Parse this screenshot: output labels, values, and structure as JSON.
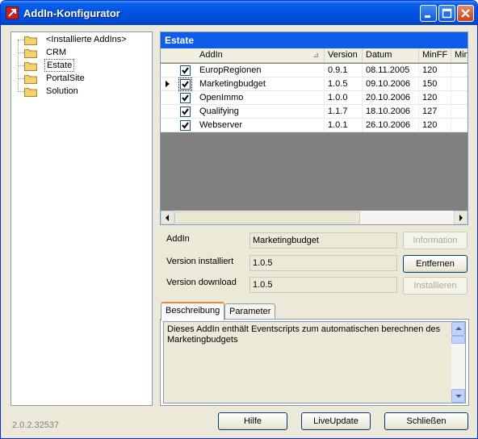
{
  "window": {
    "title": "AddIn-Konfigurator"
  },
  "tree": {
    "items": [
      {
        "label": "<Installierte AddIns>"
      },
      {
        "label": "CRM"
      },
      {
        "label": "Estate"
      },
      {
        "label": "PortalSite"
      },
      {
        "label": "Solution"
      }
    ],
    "selected": "Estate"
  },
  "grid": {
    "caption": "Estate",
    "columns": [
      "AddIn",
      "Version",
      "Datum",
      "MinFF",
      "Min"
    ],
    "rows": [
      {
        "checked": true,
        "addin": "EuropRegionen",
        "version": "0.9.1",
        "datum": "08.11.2005",
        "minff": "120"
      },
      {
        "checked": true,
        "addin": "Marketingbudget",
        "version": "1.0.5",
        "datum": "09.10.2006",
        "minff": "150"
      },
      {
        "checked": true,
        "addin": "OpenImmo",
        "version": "1.0.0",
        "datum": "20.10.2006",
        "minff": "120"
      },
      {
        "checked": true,
        "addin": "Qualifying",
        "version": "1.1.7",
        "datum": "18.10.2006",
        "minff": "127"
      },
      {
        "checked": true,
        "addin": "Webserver",
        "version": "1.0.1",
        "datum": "26.10.2006",
        "minff": "120"
      }
    ]
  },
  "details": {
    "addin_label": "AddIn",
    "addin_value": "Marketingbudget",
    "installed_label": "Version installiert",
    "installed_value": "1.0.5",
    "download_label": "Version download",
    "download_value": "1.0.5",
    "info_button": "Information",
    "remove_button": "Entfernen",
    "install_button": "Installieren"
  },
  "tabs": {
    "description_tab": "Beschreibung",
    "parameter_tab": "Parameter",
    "description_text": "Dieses AddIn enthält Eventscripts zum automatischen berechnen des Marketingbudgets"
  },
  "footer": {
    "version": "2.0.2.32537",
    "help_button": "Hilfe",
    "liveupdate_button": "LiveUpdate",
    "close_button": "Schließen"
  }
}
